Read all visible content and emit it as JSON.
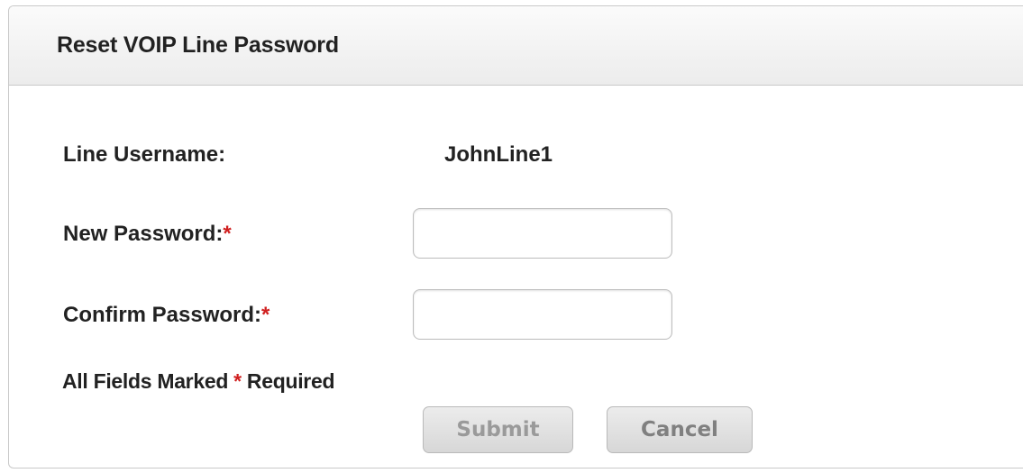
{
  "dialog": {
    "title": "Reset VOIP Line Password"
  },
  "form": {
    "line_username_label": "Line Username:",
    "line_username_value": "JohnLine1",
    "new_password_label": "New Password:",
    "confirm_password_label": "Confirm Password:",
    "required_marker": "*",
    "new_password_value": "",
    "confirm_password_value": "",
    "note_prefix": "All Fields Marked ",
    "note_suffix": " Required"
  },
  "buttons": {
    "submit_label": "Submit",
    "cancel_label": "Cancel",
    "submit_enabled": false
  },
  "colors": {
    "required": "#d01f1f",
    "header_bg": "#efefef",
    "border": "#c9c9c9"
  }
}
